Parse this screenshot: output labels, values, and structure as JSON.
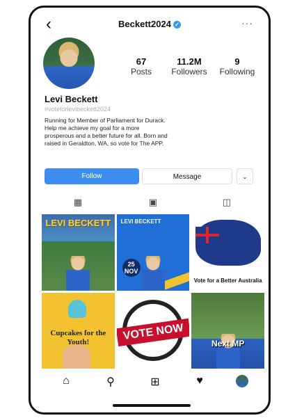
{
  "profile": {
    "username": "Beckett2024",
    "verified_icon": "verified-check-icon",
    "back_icon": "chevron-left-icon",
    "more_icon": "more-horizontal-icon",
    "name": "Levi Beckett",
    "hashtag": "#voteforlevibeckett2024",
    "bio": "Running for Member of Parliament for Durack. Help me achieve my goal for a more prosperous and a better future for all. Born and raised in Geraldton, WA, so vote for The APP."
  },
  "stats": {
    "posts": {
      "value": "67",
      "label": "Posts"
    },
    "followers": {
      "value": "11.2M",
      "label": "Followers"
    },
    "following": {
      "value": "9",
      "label": "Following"
    }
  },
  "actions": {
    "follow_label": "Follow",
    "message_label": "Message",
    "dropdown_glyph": "⌄"
  },
  "tabs": [
    {
      "icon": "grid-icon",
      "glyph": "▦"
    },
    {
      "icon": "reels-icon",
      "glyph": "▣"
    },
    {
      "icon": "tagged-icon",
      "glyph": "◫"
    }
  ],
  "grid": {
    "post1_title": "LEVI BECKETT",
    "post2_title": "LEVI BECKETT",
    "post2_date": "25 NOV",
    "post3_caption": "Vote for a Better Australia",
    "post4_caption": "Cupcakes for the Youth!",
    "post5_banner": "VOTE NOW",
    "post6_caption": "Next MP"
  },
  "bottom_nav": [
    {
      "icon": "home-icon",
      "glyph": "⌂"
    },
    {
      "icon": "search-icon",
      "glyph": "⚲"
    },
    {
      "icon": "create-icon",
      "glyph": "⊞"
    },
    {
      "icon": "heart-icon",
      "glyph": "♥"
    },
    {
      "icon": "profile-avatar-icon",
      "glyph": ""
    }
  ]
}
